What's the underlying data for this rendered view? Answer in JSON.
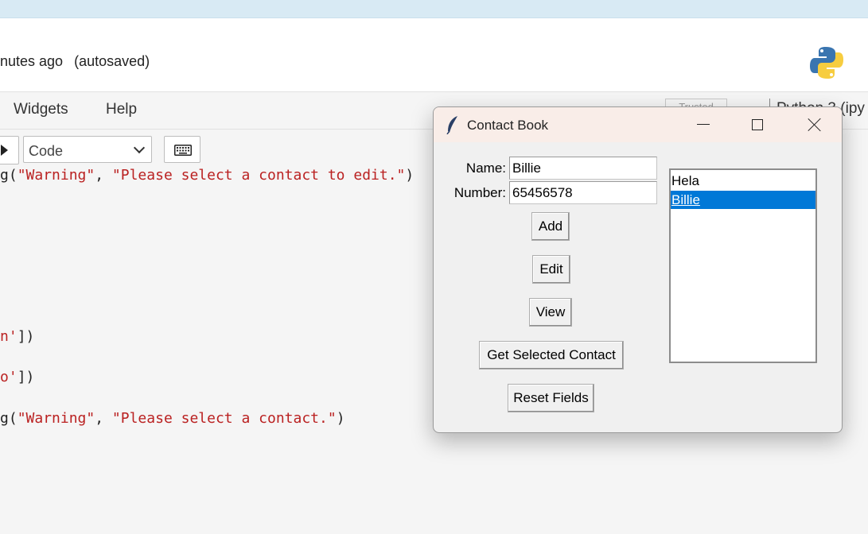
{
  "notebook": {
    "save_status": "nutes ago",
    "autosave_status": "(autosaved)",
    "menu": {
      "widgets": "Widgets",
      "help": "Help"
    },
    "trusted_label": "Trusted",
    "kernel_name": "Python 3 (ipy",
    "toolbar": {
      "cell_type": "Code"
    },
    "code_lines": [
      {
        "prefix": "g(",
        "s1": "\"Warning\"",
        "mid": ", ",
        "s2": "\"Please select a contact to edit.\"",
        "suffix": ")"
      },
      {
        "prefix": "",
        "s1": "n'",
        "suffix": "])"
      },
      {
        "prefix": "",
        "s1": "o'",
        "suffix": "])"
      },
      {
        "prefix": "g(",
        "s1": "\"Warning\"",
        "mid": ", ",
        "s2": "\"Please select a contact.\"",
        "suffix": ")"
      }
    ]
  },
  "dialog": {
    "title": "Contact Book",
    "name_label": "Name:",
    "name_value": "Billie",
    "number_label": "Number:",
    "number_value": "65456578",
    "buttons": {
      "add": "Add",
      "edit": "Edit",
      "view": "View",
      "get_selected": "Get Selected Contact",
      "reset": "Reset Fields"
    },
    "contacts": [
      "Hela",
      "Billie"
    ],
    "selected_contact": "Billie"
  },
  "colors": {
    "selection": "#0078d7",
    "string": "#ba2121",
    "titlebar": "#f9ede8"
  }
}
